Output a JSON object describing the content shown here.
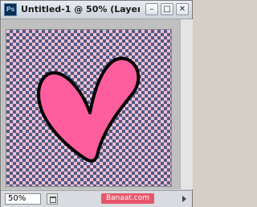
{
  "app": {
    "icon_label": "Ps"
  },
  "window": {
    "title": "Untitled-1 @ 50% (Layer 2...",
    "buttons": {
      "minimize": "–",
      "maximize": "□",
      "close": "✕"
    }
  },
  "canvas": {
    "transparency_color_light": "#f3bfd2",
    "transparency_color_dark": "#4e5a86",
    "heart_color": "#ff5e9e",
    "heart_outline": "#000000"
  },
  "statusbar": {
    "zoom": "50%",
    "watermark": "Banaat.com"
  }
}
